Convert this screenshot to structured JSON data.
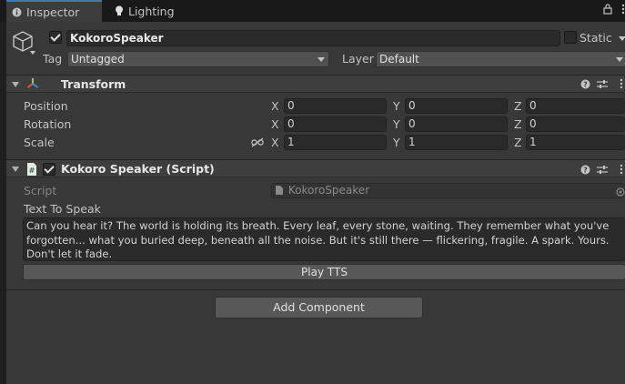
{
  "tabs": [
    {
      "label": "Inspector",
      "icon": "info-icon",
      "active": true
    },
    {
      "label": "Lighting",
      "icon": "lightbulb-icon",
      "active": false
    }
  ],
  "gameobject": {
    "active": true,
    "name": "KokoroSpeaker",
    "static_label": "Static",
    "static_checked": false,
    "tag_label": "Tag",
    "tag_value": "Untagged",
    "layer_label": "Layer",
    "layer_value": "Default"
  },
  "transform": {
    "title": "Transform",
    "rows": [
      {
        "label": "Position",
        "x": "0",
        "y": "0",
        "z": "0"
      },
      {
        "label": "Rotation",
        "x": "0",
        "y": "0",
        "z": "0"
      },
      {
        "label": "Scale",
        "x": "1",
        "y": "1",
        "z": "1"
      }
    ],
    "axes": {
      "x": "X",
      "y": "Y",
      "z": "Z"
    }
  },
  "script_component": {
    "title": "Kokoro Speaker (Script)",
    "enabled": true,
    "script_label": "Script",
    "script_value": "KokoroSpeaker",
    "text_label": "Text To Speak",
    "text_value": "Can you hear it? The world is holding its breath. Every leaf, every stone, waiting. They remember what you've forgotten... what you buried deep, beneath all the noise. But it's still there — flickering, fragile. A spark. Yours. Don't let it fade.",
    "button_label": "Play TTS"
  },
  "add_component_label": "Add Component",
  "colors": {
    "accent": "#3a79bb",
    "panel": "#383838",
    "field": "#2a2a2a"
  }
}
